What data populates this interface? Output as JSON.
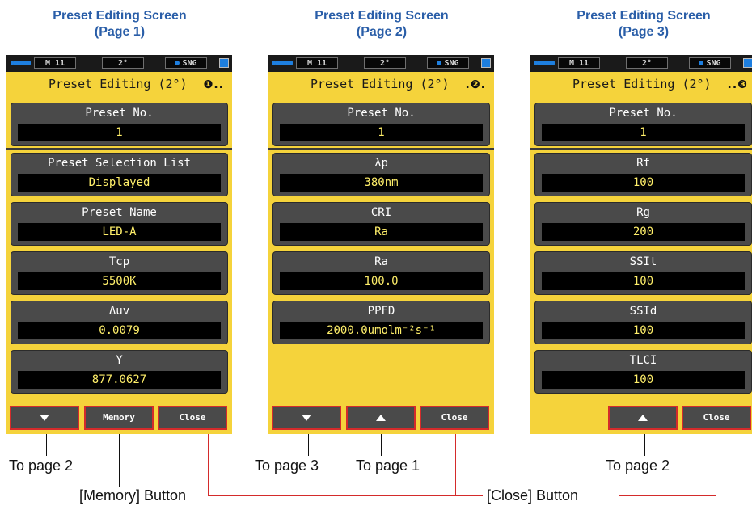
{
  "captions": [
    {
      "line1": "Preset Editing Screen",
      "line2": "(Page 1)"
    },
    {
      "line1": "Preset Editing Screen",
      "line2": "(Page 2)"
    },
    {
      "line1": "Preset Editing Screen",
      "line2": "(Page 3)"
    }
  ],
  "status": {
    "memory": "M 11",
    "angle": "2°",
    "mode": "SNG"
  },
  "screen_title": "Preset Editing (2°)",
  "page_markers": [
    "❶..",
    ".❷.",
    "..❸"
  ],
  "preset_no": {
    "label": "Preset No.",
    "value": "1"
  },
  "page1": {
    "fields": [
      {
        "label": "Preset Selection List",
        "value": "Displayed"
      },
      {
        "label": "Preset Name",
        "value": "LED-A"
      },
      {
        "label": "Tcp",
        "value": "5500K"
      },
      {
        "label": "Δuv",
        "value": "0.0079"
      },
      {
        "label": "Y",
        "value": "877.0627"
      }
    ],
    "buttons": {
      "down": "down",
      "memory": "Memory",
      "close": "Close"
    }
  },
  "page2": {
    "fields": [
      {
        "label": "λp",
        "value": "380nm"
      },
      {
        "label": "CRI",
        "value": "Ra"
      },
      {
        "label": "Ra",
        "value": "100.0"
      },
      {
        "label": "PPFD",
        "value": "2000.0umolm⁻²s⁻¹"
      }
    ],
    "buttons": {
      "close": "Close"
    }
  },
  "page3": {
    "fields": [
      {
        "label": "Rf",
        "value": "100"
      },
      {
        "label": "Rg",
        "value": "200"
      },
      {
        "label": "SSIt",
        "value": "100"
      },
      {
        "label": "SSId",
        "value": "100"
      },
      {
        "label": "TLCI",
        "value": "100"
      }
    ],
    "buttons": {
      "close": "Close"
    }
  },
  "callouts": {
    "to_page2": "To page 2",
    "to_page3": "To page 3",
    "to_page1": "To page 1",
    "memory_button": "[Memory] Button",
    "close_button": "[Close] Button",
    "to_page2_b": "To page 2"
  },
  "colors": {
    "accent_blue": "#2a5ea8",
    "screen_yellow": "#f5d33b",
    "callout_red": "#d42b2b"
  }
}
